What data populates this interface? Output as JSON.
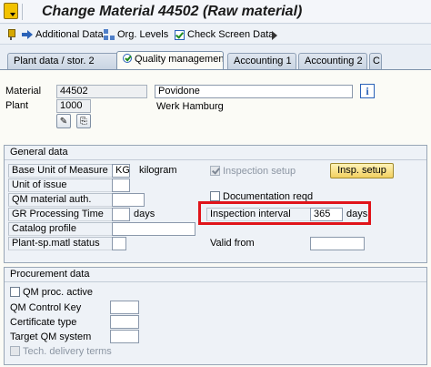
{
  "window": {
    "title": "Change Material 44502 (Raw material)"
  },
  "toolbar": {
    "additional_data": "Additional Data",
    "org_levels": "Org. Levels",
    "check_screen_data": "Check Screen Data"
  },
  "tabs": [
    {
      "label": "Plant data / stor. 2"
    },
    {
      "label": "Quality management"
    },
    {
      "label": "Accounting 1"
    },
    {
      "label": "Accounting 2"
    },
    {
      "label": "C"
    }
  ],
  "header": {
    "material_label": "Material",
    "material_value": "44502",
    "material_desc": "Povidone",
    "plant_label": "Plant",
    "plant_value": "1000",
    "plant_desc": "Werk Hamburg"
  },
  "general": {
    "title": "General data",
    "base_uom_label": "Base Unit of Measure",
    "base_uom_value": "KG",
    "base_uom_text": "kilogram",
    "unit_issue_label": "Unit of issue",
    "qm_auth_label": "QM material auth.",
    "gr_time_label": "GR Processing Time",
    "gr_time_unit": "days",
    "catalog_label": "Catalog profile",
    "plant_status_label": "Plant-sp.matl status",
    "inspection_setup_label": "Inspection setup",
    "insp_setup_button": "Insp. setup",
    "documentation_label": "Documentation reqd",
    "interval_label": "Inspection interval",
    "interval_value": "365",
    "interval_unit": "days",
    "valid_from_label": "Valid from"
  },
  "procurement": {
    "title": "Procurement data",
    "qm_proc_label": "QM proc. active",
    "qm_control_label": "QM Control Key",
    "cert_type_label": "Certificate type",
    "target_qm_label": "Target QM system",
    "tech_terms_label": "Tech. delivery terms"
  }
}
